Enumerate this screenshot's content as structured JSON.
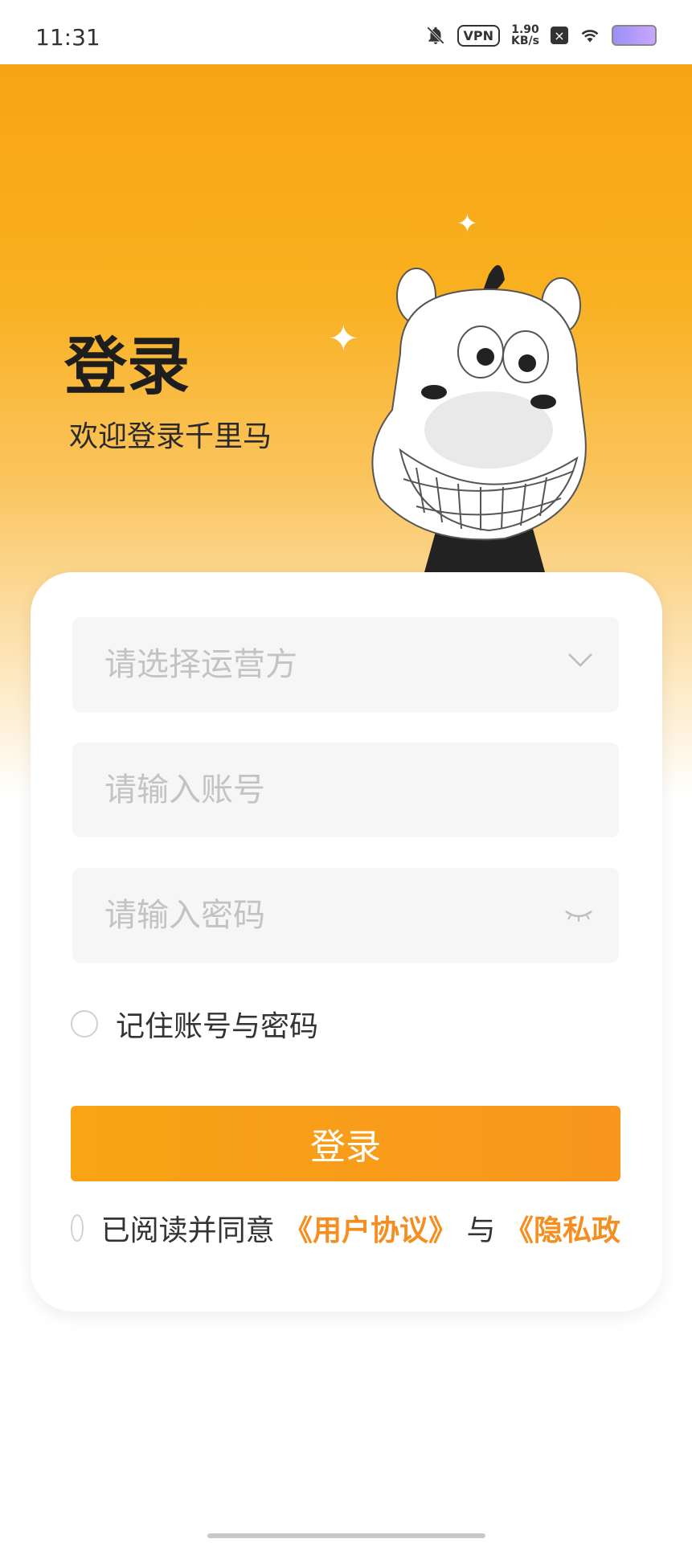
{
  "status_bar": {
    "time": "11:31",
    "vpn": "VPN",
    "speed_value": "1.90",
    "speed_unit": "KB/s",
    "icons": [
      "bell-muted-icon",
      "vpn-icon",
      "close-box-icon",
      "wifi-icon",
      "battery-icon"
    ]
  },
  "header": {
    "title": "登录",
    "subtitle": "欢迎登录千里马"
  },
  "form": {
    "operator_placeholder": "请选择运营方",
    "account_placeholder": "请输入账号",
    "password_placeholder": "请输入密码",
    "remember_label": "记住账号与密码",
    "login_button": "登录"
  },
  "agreement": {
    "prefix": "已阅读并同意",
    "user_agreement": "《用户协议》",
    "and": "与",
    "privacy_policy": "《隐私政"
  },
  "colors": {
    "accent": "#F8A414",
    "link": "#F58E1E",
    "field_bg": "#F6F6F6"
  }
}
